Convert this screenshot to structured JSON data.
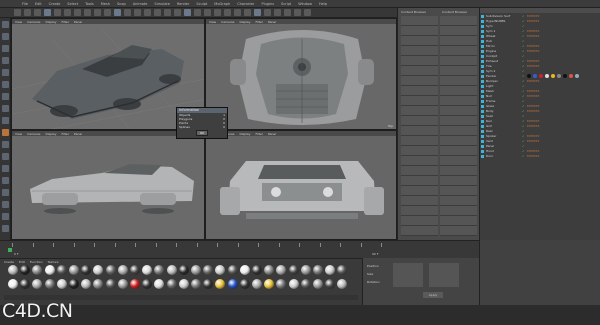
{
  "menu": {
    "items": [
      "File",
      "Edit",
      "Create",
      "Select",
      "Tools",
      "Mesh",
      "Snap",
      "Animate",
      "Simulate",
      "Render",
      "Sculpt",
      "MoGraph",
      "Character",
      "Plugins",
      "Script",
      "Window",
      "Help"
    ]
  },
  "viewports": {
    "perspective": {
      "label": "Perspective",
      "menu": [
        "View",
        "Cameras",
        "Display",
        "Filter",
        "Panel"
      ]
    },
    "top": {
      "label": "Top",
      "menu": [
        "View",
        "Cameras",
        "Display",
        "Filter",
        "Panel"
      ]
    },
    "right": {
      "label": "Right",
      "menu": [
        "View",
        "Cameras",
        "Display",
        "Filter",
        "Panel"
      ]
    },
    "front": {
      "label": "Front",
      "menu": [
        "View",
        "Cameras",
        "Display",
        "Filter",
        "Panel"
      ]
    }
  },
  "dialog": {
    "title": "Information",
    "rows": [
      [
        "Objects",
        "1"
      ],
      [
        "Polygons",
        "0"
      ],
      [
        "Points",
        "0"
      ],
      [
        "Splines",
        "0"
      ]
    ],
    "ok": "OK"
  },
  "midpanel": {
    "left_title": "Content Browser",
    "right_title": "Content Browser",
    "left_item": "Polygon Pen",
    "right_item": "Polygon Pen"
  },
  "objects": [
    "Subdivision Surf",
    "HyperNURBS",
    "Sym",
    "Sym 1",
    "Wheel",
    "Hub",
    "Mirror",
    "Engine",
    "Cockpit",
    "Exhaust",
    "Tire",
    "Sym 2",
    "Fender",
    "Bumper",
    "Light",
    "Mesh",
    "Null",
    "Frame",
    "Glass",
    "Body",
    "Seat",
    "Rail",
    "Grill",
    "Rear",
    "Spoiler",
    "Vent",
    "Panel",
    "Hood",
    "Door"
  ],
  "timeline": {
    "start": "0 F",
    "end": "90 F"
  },
  "materials": {
    "menu": [
      "Create",
      "Edit",
      "Function",
      "Texture"
    ]
  },
  "coords": {
    "rows": [
      "Position",
      "Size",
      "Rotation"
    ],
    "apply": "Apply"
  },
  "watermark": "C4D.CN"
}
